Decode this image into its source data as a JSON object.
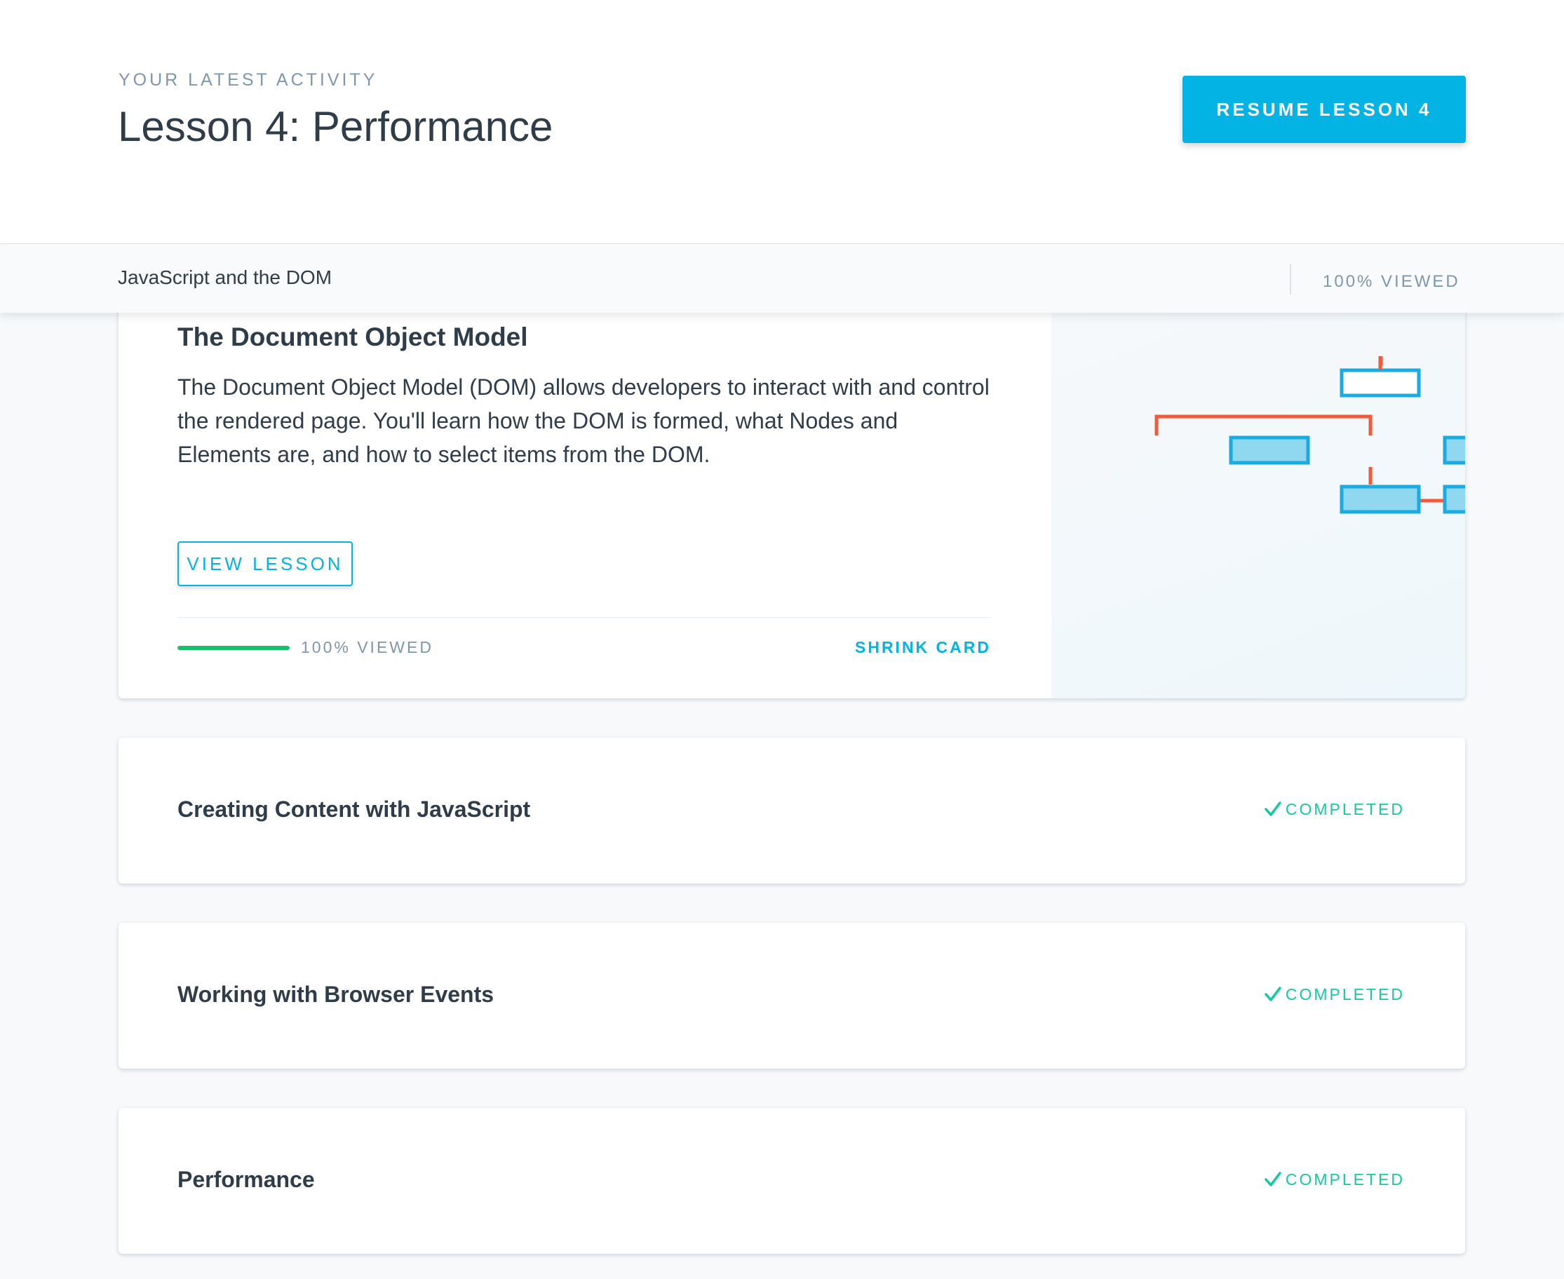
{
  "header": {
    "eyebrow": "YOUR LATEST ACTIVITY",
    "title": "Lesson 4: Performance",
    "resume_label": "RESUME LESSON 4"
  },
  "subbar": {
    "title": "JavaScript and the DOM",
    "status": "100% VIEWED"
  },
  "expanded_card": {
    "title": "The Document Object Model",
    "description": "The Document Object Model (DOM) allows developers to interact with and control the rendered page. You'll learn how the DOM is formed, what Nodes and Elements are, and how to select items from the DOM.",
    "view_label": "VIEW LESSON",
    "progress_percent": 100,
    "progress_label": "100% VIEWED",
    "shrink_label": "SHRINK CARD",
    "illustration": "dom-tree-diagram"
  },
  "lessons": [
    {
      "title": "Creating Content with JavaScript",
      "status": "COMPLETED",
      "icon": "checkmark-icon"
    },
    {
      "title": "Working with Browser Events",
      "status": "COMPLETED",
      "icon": "checkmark-icon"
    },
    {
      "title": "Performance",
      "status": "COMPLETED",
      "icon": "checkmark-icon"
    }
  ],
  "colors": {
    "accent": "#02b3e4",
    "progress": "#15c26b",
    "completed": "#15c9a0",
    "diagram_line": "#f15a3a",
    "diagram_box_fill": "#8fd8ef"
  }
}
